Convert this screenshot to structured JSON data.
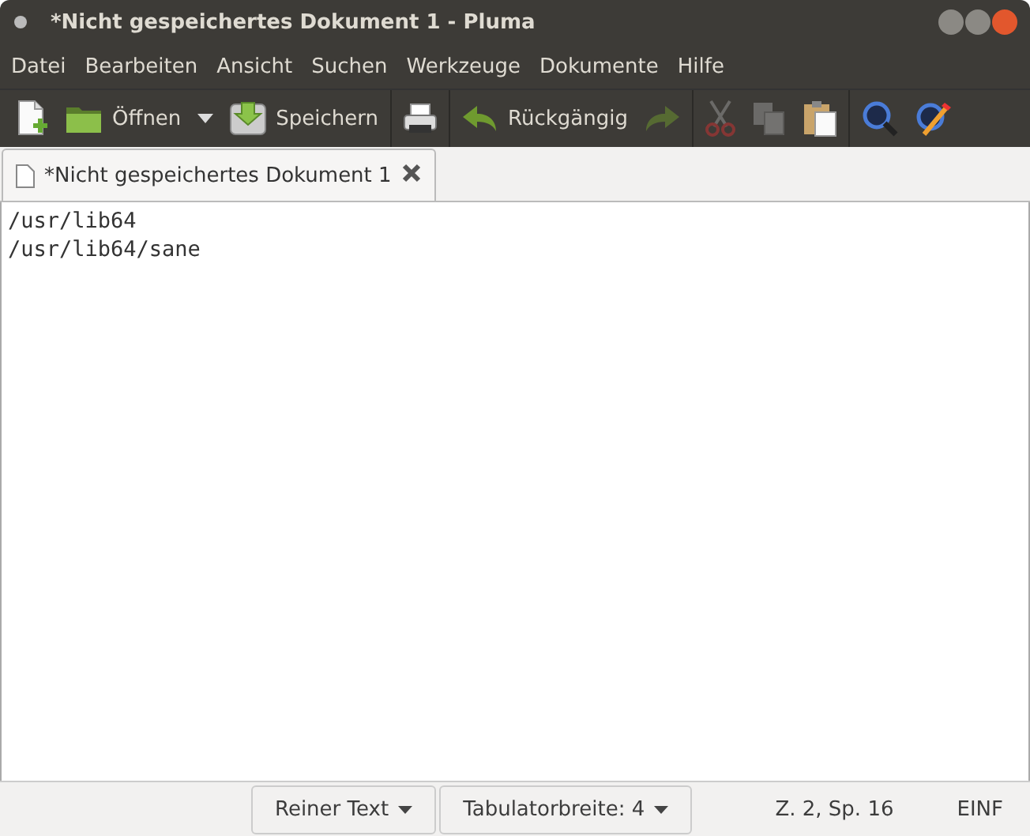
{
  "window": {
    "title": "*Nicht gespeichertes Dokument 1 - Pluma"
  },
  "menu": [
    "Datei",
    "Bearbeiten",
    "Ansicht",
    "Suchen",
    "Werkzeuge",
    "Dokumente",
    "Hilfe"
  ],
  "toolbar": [
    {
      "kind": "button",
      "disabled": false
    },
    {
      "kind": "button",
      "label": "Öffnen",
      "disabled": false
    },
    {
      "kind": "dropdown",
      "disabled": false
    },
    {
      "kind": "button",
      "label": "Speichern",
      "disabled": false
    },
    {
      "kind": "separator"
    },
    {
      "kind": "button",
      "disabled": false
    },
    {
      "kind": "separator"
    },
    {
      "kind": "button",
      "label": "Rückgängig",
      "disabled": false
    },
    {
      "kind": "button",
      "disabled": true
    },
    {
      "kind": "separator"
    },
    {
      "kind": "button",
      "disabled": true
    },
    {
      "kind": "button",
      "disabled": true
    },
    {
      "kind": "button",
      "disabled": false
    },
    {
      "kind": "separator"
    },
    {
      "kind": "button",
      "disabled": false
    },
    {
      "kind": "button",
      "disabled": false
    }
  ],
  "tabs": [
    {
      "label": "*Nicht gespeichertes Dokument 1",
      "selected": true
    }
  ],
  "editor": {
    "lines": [
      "/usr/lib64",
      "/usr/lib64/sane"
    ]
  },
  "status_bar": {
    "language": "Reiner Text",
    "tab_width": "Tabulatorbreite: 4",
    "position": "Z. 2, Sp. 16",
    "mode": "EINF"
  }
}
